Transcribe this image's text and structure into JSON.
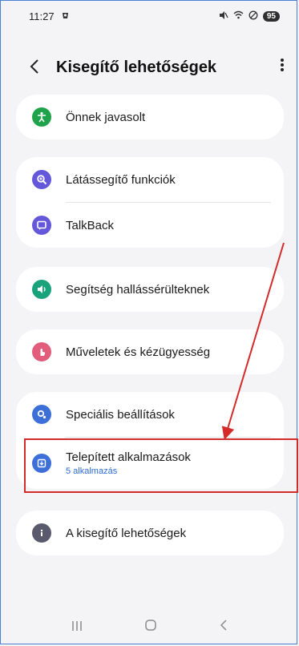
{
  "status": {
    "time": "11:27",
    "battery": "95"
  },
  "header": {
    "title": "Kisegítő lehetőségek"
  },
  "groups": [
    {
      "items": [
        {
          "label": "Önnek javasolt",
          "icon": "accessibility-person-icon",
          "color": "#1fa34a"
        }
      ]
    },
    {
      "items": [
        {
          "label": "Látássegítő funkciók",
          "icon": "magnifier-icon",
          "color": "#6457d9"
        },
        {
          "label": "TalkBack",
          "icon": "chat-bubble-icon",
          "color": "#6457d9"
        }
      ]
    },
    {
      "items": [
        {
          "label": "Segítség hallássérülteknek",
          "icon": "speaker-icon",
          "color": "#19a27b"
        }
      ]
    },
    {
      "items": [
        {
          "label": "Műveletek és kézügyesség",
          "icon": "touch-hand-icon",
          "color": "#e25c7c"
        }
      ]
    },
    {
      "items": [
        {
          "label": "Speciális beállítások",
          "icon": "gears-icon",
          "color": "#3d6fd9"
        },
        {
          "label": "Telepített alkalmazások",
          "sub": "5 alkalmazás",
          "icon": "download-icon",
          "color": "#3d6fd9"
        }
      ]
    },
    {
      "items": [
        {
          "label": "A kisegítő lehetőségek",
          "icon": "info-icon",
          "color": "#5a5a6e"
        }
      ]
    }
  ],
  "annotation": {
    "color": "#d42a2a"
  }
}
